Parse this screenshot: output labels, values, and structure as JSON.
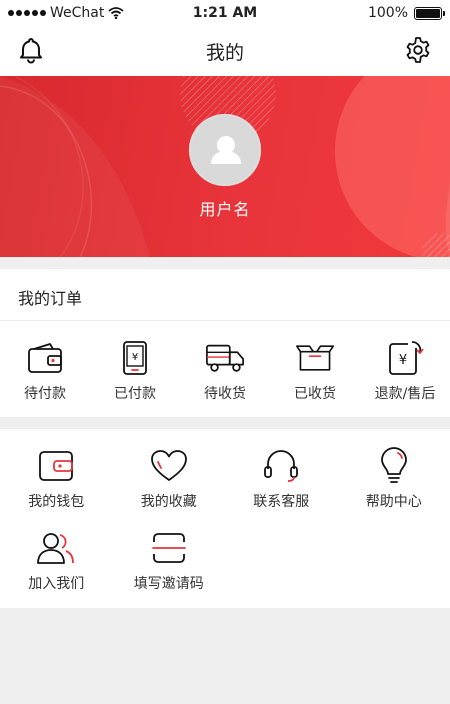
{
  "status_bar": {
    "carrier": "WeChat",
    "time": "1:21 AM",
    "battery": "100%"
  },
  "nav": {
    "title": "我的"
  },
  "profile": {
    "username": "用户名"
  },
  "orders": {
    "title": "我的订单",
    "items": [
      {
        "label": "待付款",
        "icon": "wallet-icon"
      },
      {
        "label": "已付款",
        "icon": "paid-phone-icon"
      },
      {
        "label": "待收货",
        "icon": "truck-icon"
      },
      {
        "label": "已收货",
        "icon": "box-icon"
      },
      {
        "label": "退款/售后",
        "icon": "refund-icon"
      }
    ]
  },
  "services": {
    "items": [
      {
        "label": "我的钱包",
        "icon": "card-wallet-icon"
      },
      {
        "label": "我的收藏",
        "icon": "heart-icon"
      },
      {
        "label": "联系客服",
        "icon": "headset-icon"
      },
      {
        "label": "帮助中心",
        "icon": "lightbulb-icon"
      },
      {
        "label": "加入我们",
        "icon": "people-icon"
      },
      {
        "label": "填写邀请码",
        "icon": "scan-icon"
      }
    ]
  },
  "colors": {
    "brand_red": "#e8343a",
    "accent_red": "#f04a4a",
    "text": "#222222",
    "background": "#efefef"
  }
}
